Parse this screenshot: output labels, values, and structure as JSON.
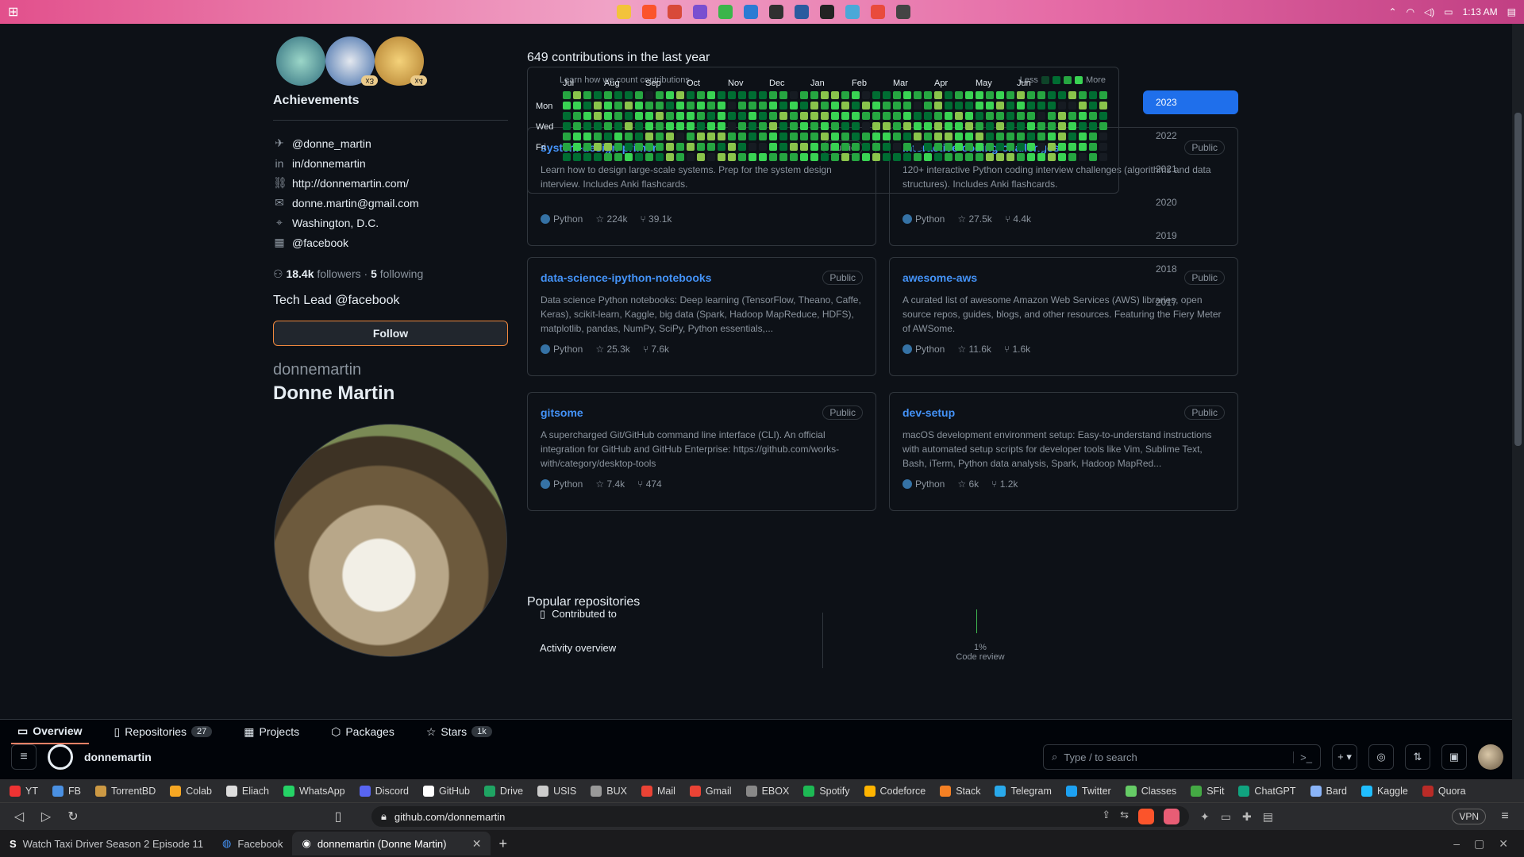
{
  "tabs": [
    {
      "label": "Watch Taxi Driver Season 2 Episode 11",
      "active": false
    },
    {
      "label": "Facebook",
      "active": false
    },
    {
      "label": "donnemartin (Donne Martin)",
      "active": true
    }
  ],
  "addressbar": {
    "url": "github.com/donnemartin",
    "vpn": "VPN"
  },
  "bookmarks": [
    "YT",
    "FB",
    "TorrentBD",
    "Colab",
    "Eliach",
    "WhatsApp",
    "Discord",
    "GitHub",
    "Drive",
    "USIS",
    "BUX",
    "Mail",
    "Gmail",
    "EBOX",
    "Spotify",
    "Codeforce",
    "Stack",
    "Telegram",
    "Twitter",
    "Classes",
    "SFit",
    "ChatGPT",
    "Bard",
    "Kaggle",
    "Quora"
  ],
  "github": {
    "username": "donnemartin",
    "search_placeholder": "Type / to search",
    "search_key": "/",
    "tabs": [
      {
        "label": "Overview",
        "selected": true
      },
      {
        "label": "Repositories",
        "count": "27"
      },
      {
        "label": "Projects"
      },
      {
        "label": "Packages"
      },
      {
        "label": "Stars",
        "count": "1k"
      }
    ]
  },
  "profile": {
    "name": "Donne Martin",
    "login": "donnemartin",
    "follow_label": "Follow",
    "bio": "Tech Lead @facebook",
    "followers": "18.4k",
    "followers_label": "followers",
    "following": "5",
    "following_label": "following",
    "company": "@facebook",
    "location": "Washington, D.C.",
    "email": "donne.martin@gmail.com",
    "website": "http://donnemartin.com/",
    "linkedin": "in/donnemartin",
    "twitter": "@donne_martin",
    "achievements_title": "Achievements",
    "achievement_counts": [
      "x3",
      "x4"
    ]
  },
  "popular_title": "Popular repositories",
  "repos": [
    {
      "name": "system-design-primer",
      "visibility": "Public",
      "desc": "Learn how to design large-scale systems. Prep for the system design interview. Includes Anki flashcards.",
      "lang": "Python",
      "stars": "224k",
      "forks": "39.1k"
    },
    {
      "name": "interactive-coding-challenges",
      "visibility": "Public",
      "desc": "120+ interactive Python coding interview challenges (algorithms and data structures). Includes Anki flashcards.",
      "lang": "Python",
      "stars": "27.5k",
      "forks": "4.4k"
    },
    {
      "name": "data-science-ipython-notebooks",
      "visibility": "Public",
      "desc": "Data science Python notebooks: Deep learning (TensorFlow, Theano, Caffe, Keras), scikit-learn, Kaggle, big data (Spark, Hadoop MapReduce, HDFS), matplotlib, pandas, NumPy, SciPy, Python essentials,...",
      "lang": "Python",
      "stars": "25.3k",
      "forks": "7.6k"
    },
    {
      "name": "awesome-aws",
      "visibility": "Public",
      "desc": "A curated list of awesome Amazon Web Services (AWS) libraries, open source repos, guides, blogs, and other resources. Featuring the Fiery Meter of AWSome.",
      "lang": "Python",
      "stars": "11.6k",
      "forks": "1.6k"
    },
    {
      "name": "gitsome",
      "visibility": "Public",
      "desc": "A supercharged Git/GitHub command line interface (CLI). An official integration for GitHub and GitHub Enterprise: https://github.com/works-with/category/desktop-tools",
      "lang": "Python",
      "stars": "7.4k",
      "forks": "474"
    },
    {
      "name": "dev-setup",
      "visibility": "Public",
      "desc": "macOS development environment setup: Easy-to-understand instructions with automated setup scripts for developer tools like Vim, Sublime Text, Bash, iTerm, Python data analysis, Spark, Hadoop MapRed...",
      "lang": "Python",
      "stars": "6k",
      "forks": "1.2k"
    }
  ],
  "contributions": {
    "title": "649 contributions in the last year",
    "months": [
      "Jul",
      "Aug",
      "Sep",
      "Oct",
      "Nov",
      "Dec",
      "Jan",
      "Feb",
      "Mar",
      "Apr",
      "May",
      "Jun"
    ],
    "days": [
      "Mon",
      "Wed",
      "Fri"
    ],
    "learn": "Learn how we count contributions",
    "less": "Less",
    "more": "More",
    "colors": [
      "#161b22",
      "#0e4429",
      "#006d32",
      "#26a641",
      "#39d353",
      "#8ac44b"
    ]
  },
  "years": [
    "2023",
    "2022",
    "2021",
    "2020",
    "2019",
    "2018",
    "2017"
  ],
  "activity": {
    "title": "Activity overview",
    "contributed_to": "Contributed to",
    "code_review_pct": "1%",
    "code_review_label": "Code review"
  },
  "taskbar": {
    "time": "1:13 AM"
  }
}
